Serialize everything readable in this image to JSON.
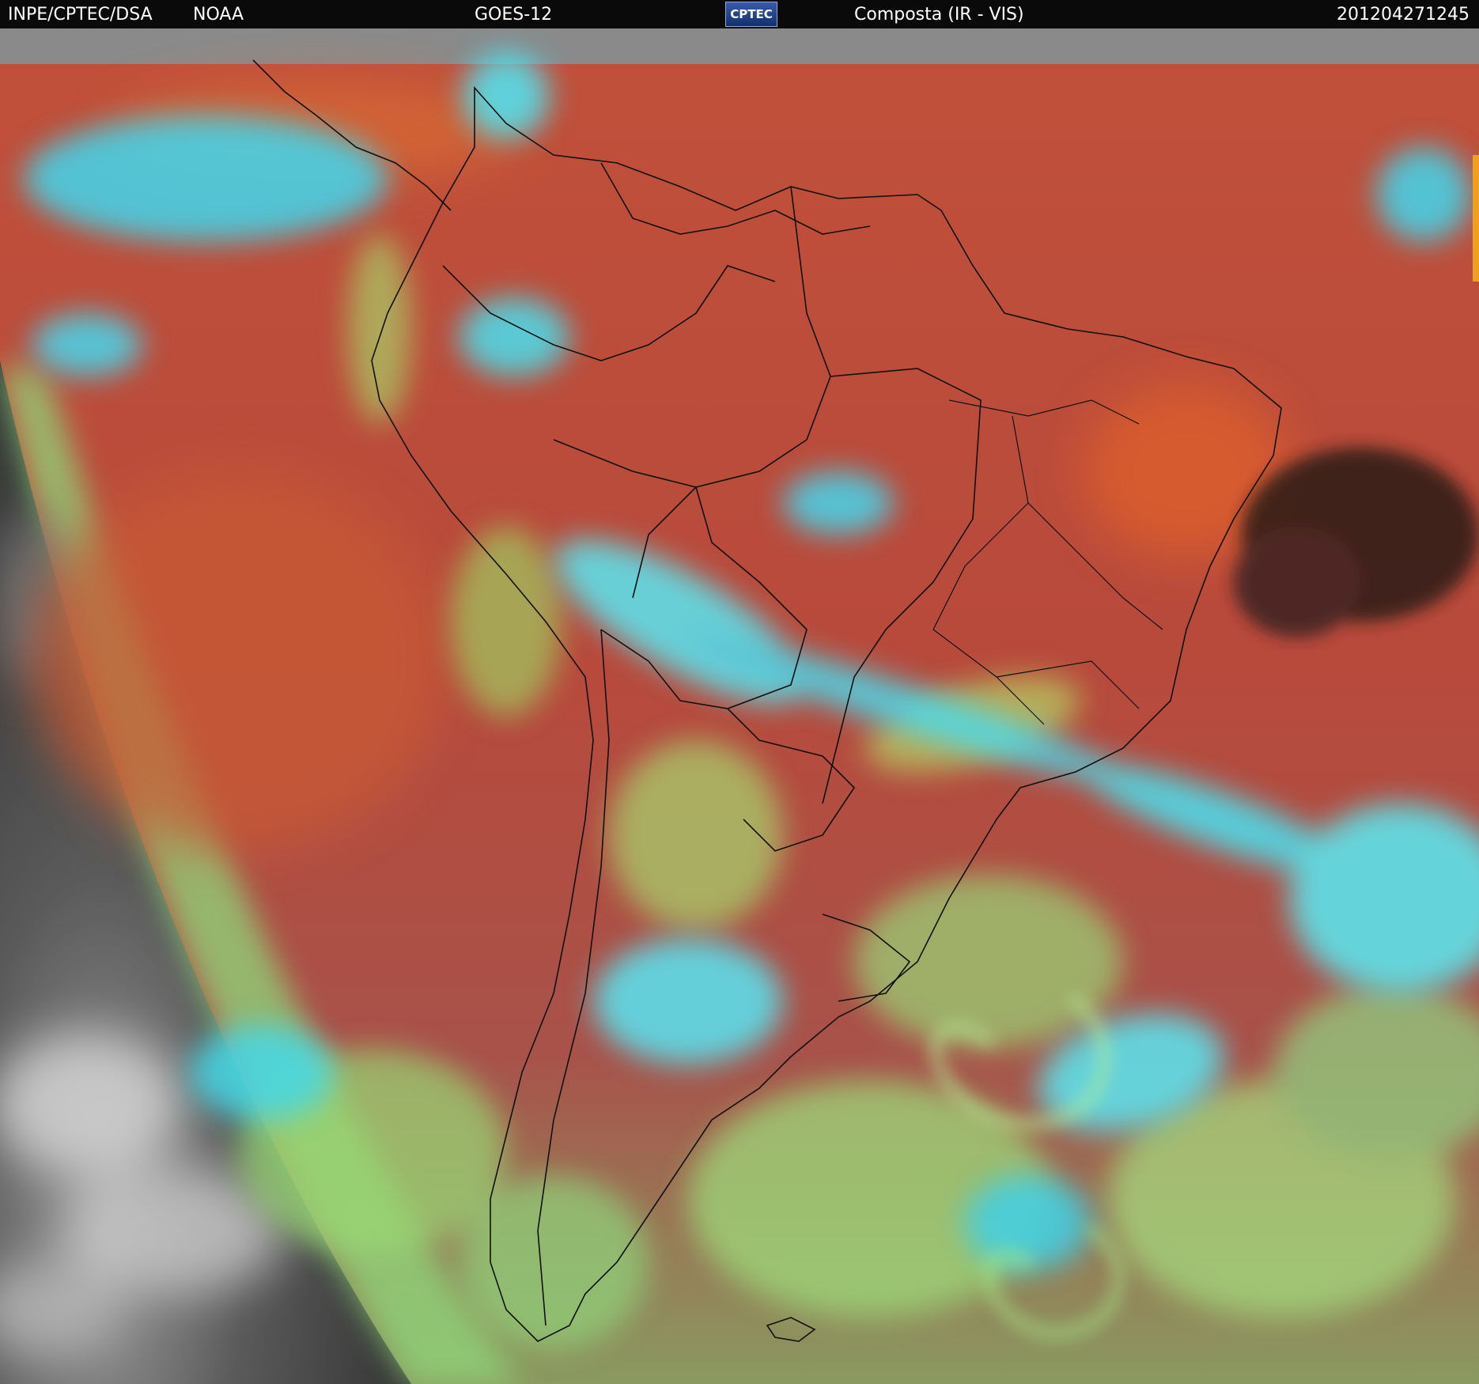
{
  "header": {
    "source": "INPE/CPTEC/DSA",
    "agency": "NOAA",
    "satellite": "GOES-12",
    "logo_text": "CPTEC",
    "product": "Composta (IR - VIS)",
    "timestamp": "201204271245"
  },
  "colors": {
    "header_bg": "#0a0a0a",
    "ocean_warm": "#b54a3a",
    "land_warm": "#a63a34",
    "cloud_cold": "#3fe6f0",
    "cloud_mid": "#8fe07c",
    "space_night": "#4a4a4a",
    "top_band": "#8a8a8a"
  }
}
